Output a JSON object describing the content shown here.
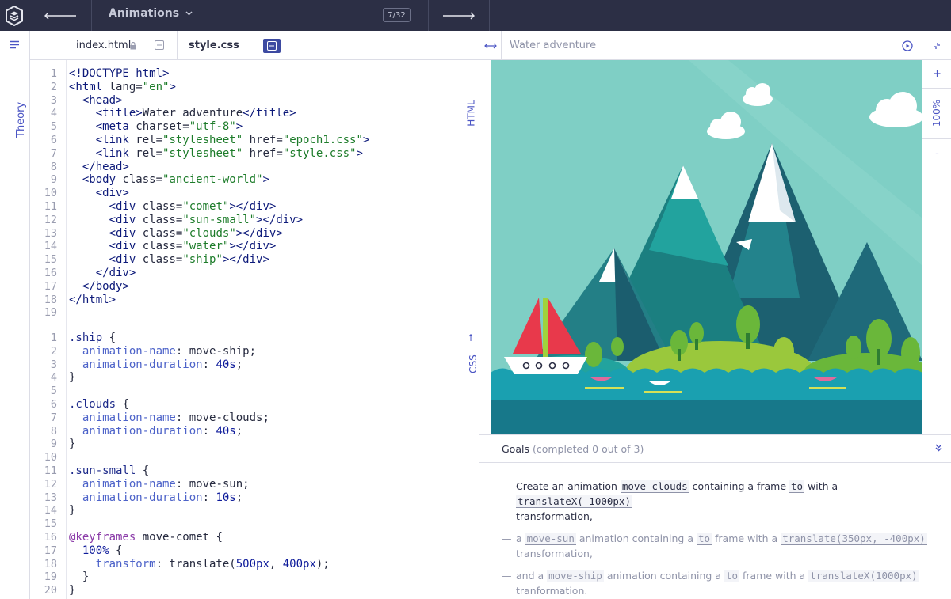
{
  "topbar": {
    "module_title": "Animations",
    "level_counter": "7/32"
  },
  "sidebar": {
    "theory_label": "Theory"
  },
  "tabs": [
    {
      "label": "index.html",
      "locked": true
    },
    {
      "label": "style.css",
      "active": true
    }
  ],
  "html_pane": {
    "label": "HTML",
    "line_numbers": [
      "1",
      "2",
      "3",
      "4",
      "5",
      "6",
      "7",
      "8",
      "9",
      "10",
      "11",
      "12",
      "13",
      "14",
      "15",
      "16",
      "17",
      "18",
      "19"
    ]
  },
  "css_pane": {
    "label": "CSS",
    "line_numbers": [
      "1",
      "2",
      "3",
      "4",
      "5",
      "6",
      "7",
      "8",
      "9",
      "10",
      "11",
      "12",
      "13",
      "14",
      "15",
      "16",
      "17",
      "18",
      "19",
      "20"
    ]
  },
  "preview": {
    "title": "Water adventure",
    "zoom_plus": "+",
    "zoom_level": "100%",
    "zoom_minus": "-"
  },
  "goals": {
    "title": "Goals",
    "status": "(completed 0 out of 3)",
    "items": [
      {
        "pre": "Create an animation ",
        "code1": "move-clouds",
        "mid1": " containing a frame ",
        "code2": "to",
        "mid2": " with a ",
        "code3": "translateX(-1000px)",
        "post": "transformation,"
      },
      {
        "pre": "a ",
        "code1": "move-sun",
        "mid1": " animation containing a ",
        "code2": "to",
        "mid2": " frame with a ",
        "code3": "translate(350px, -400px)",
        "post": "transformation,"
      },
      {
        "pre": "and a ",
        "code1": "move-ship",
        "mid1": " animation containing a ",
        "code2": "to",
        "mid2": " frame with a ",
        "code3": "translateX(1000px)",
        "post": "tranformation."
      }
    ]
  },
  "colors": {
    "topbar_bg": "#2c2f45",
    "accent": "#4b55c4",
    "sky": "#7fcfc5",
    "water": "#1aa0b0"
  }
}
